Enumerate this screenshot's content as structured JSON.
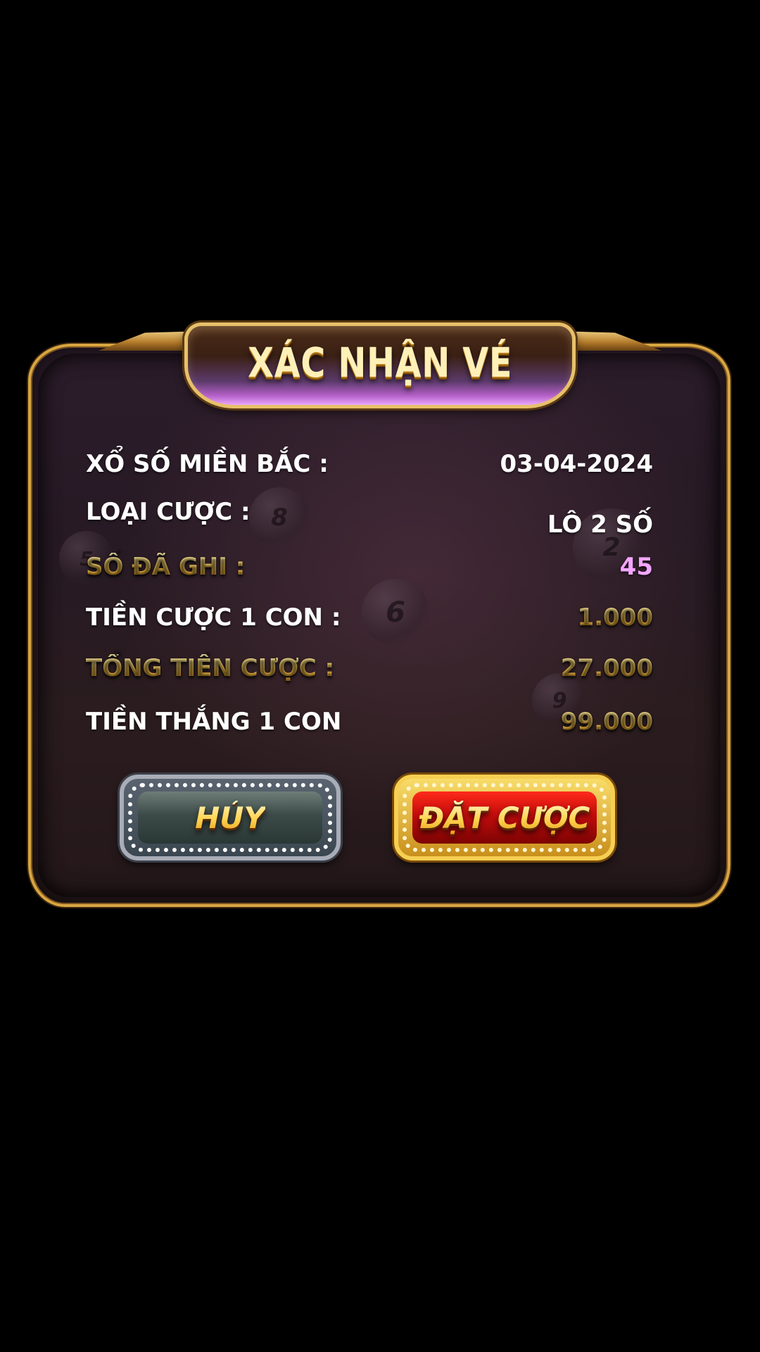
{
  "dialog": {
    "title": "XÁC NHẬN VÉ",
    "rows": [
      {
        "label": "XỔ SỐ MIỀN BẮC :",
        "value": "03-04-2024"
      },
      {
        "label": "LOẠI CƯỢC :",
        "value": "LÔ 2 SỐ"
      },
      {
        "label": "SỐ ĐÃ GHI :",
        "value": "45"
      },
      {
        "label": "TIỀN CƯỢC 1 CON :",
        "value": "1.000"
      },
      {
        "label": "TỔNG TIỀN CƯỢC :",
        "value": "27.000"
      },
      {
        "label": "TIỀN THẮNG 1 CON",
        "value": "99.000"
      }
    ],
    "buttons": {
      "cancel_label": "HỦY",
      "place_bet_label": "ĐẶT CƯỢC"
    },
    "background_balls": [
      "8",
      "5",
      "6",
      "2",
      "9"
    ]
  },
  "colors": {
    "frame_gold": "#d9a640",
    "panel_bg": "#2b1c2a",
    "label_gold": "#f6c44b",
    "value_pink": "#f3a6ff",
    "cancel_button": "#3c4b48",
    "place_bet_button": "#c40c0c"
  }
}
